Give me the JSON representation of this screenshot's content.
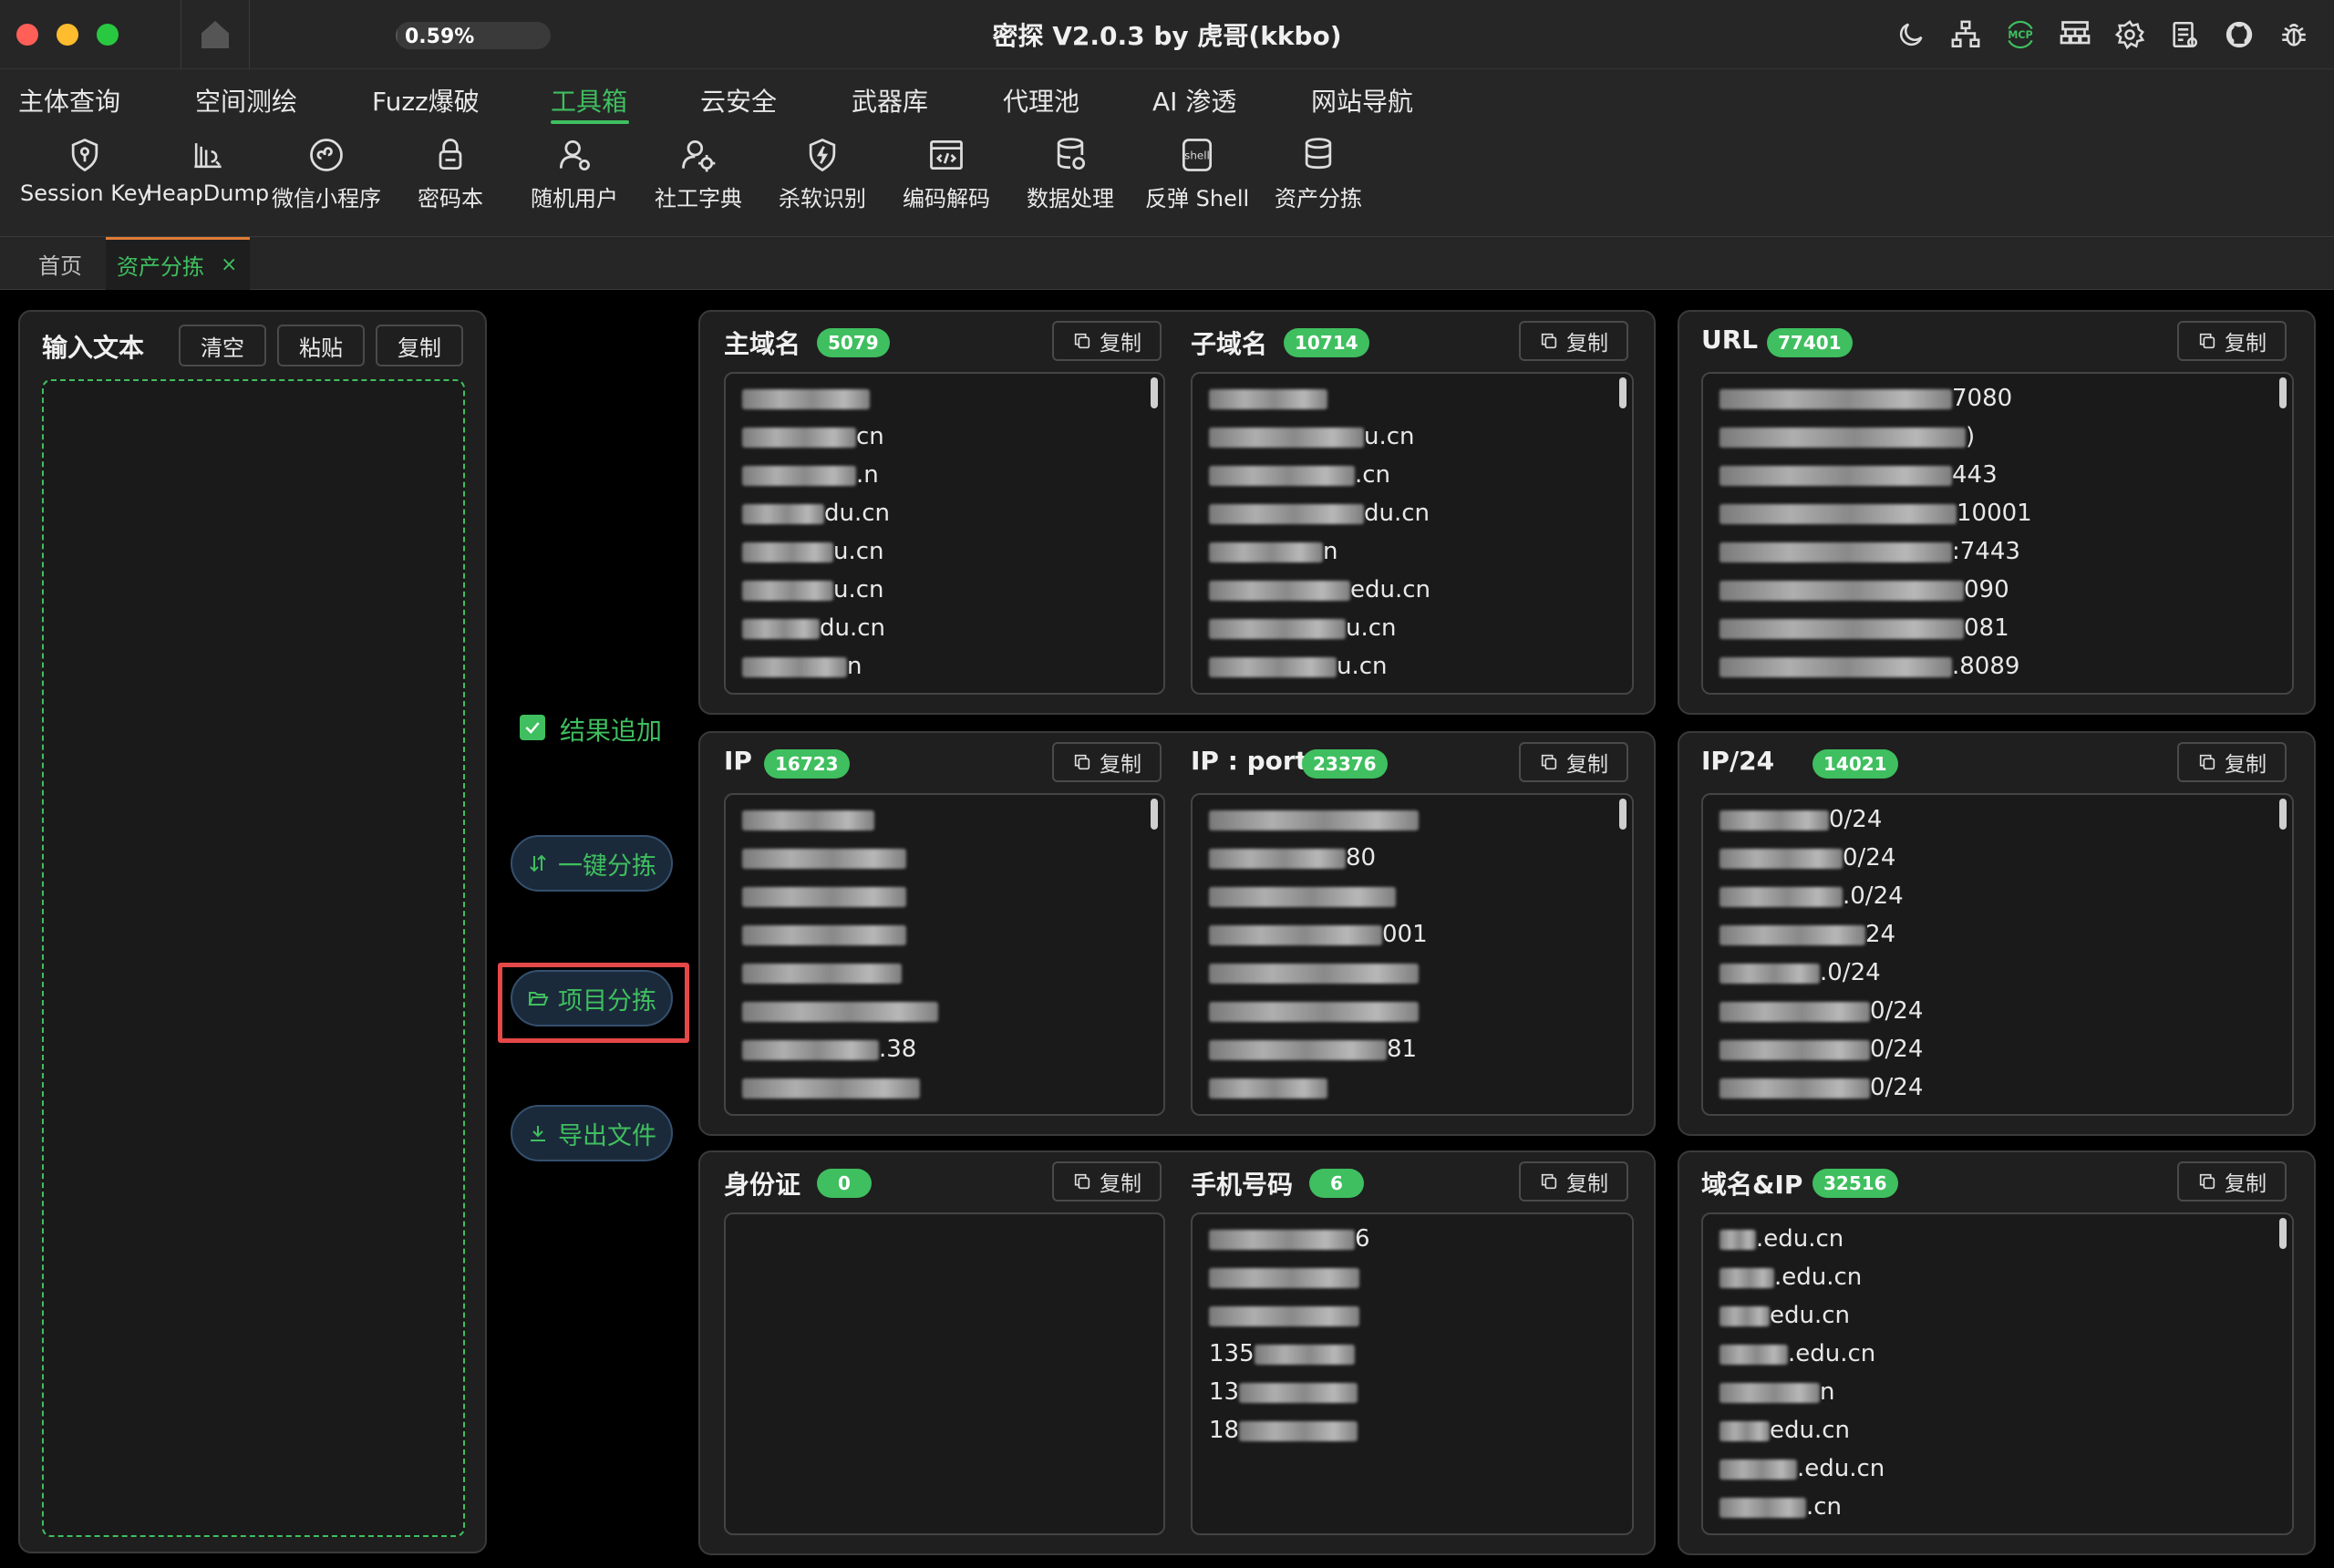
{
  "app": {
    "title": "密探 V2.0.3 by 虎哥(kkbo)",
    "progress_text": "0.59%",
    "progress_value": 0.59
  },
  "top_icons": [
    "moon-icon",
    "network-icon",
    "mcp-icon",
    "sitemap-icon",
    "settings-icon",
    "log-icon",
    "github-icon",
    "bug-icon"
  ],
  "mcp_label": "MCP",
  "menu": {
    "items": [
      {
        "label": "主体查询"
      },
      {
        "label": "空间测绘"
      },
      {
        "label": "Fuzz爆破"
      },
      {
        "label": "工具箱",
        "active": true
      },
      {
        "label": "云安全"
      },
      {
        "label": "武器库"
      },
      {
        "label": "代理池"
      },
      {
        "label": "AI 渗透"
      },
      {
        "label": "网站导航"
      }
    ]
  },
  "tools": [
    {
      "label": "Session Key",
      "icon": "key-shield-icon"
    },
    {
      "label": "HeapDump",
      "icon": "heapdump-icon"
    },
    {
      "label": "微信小程序",
      "icon": "miniprogram-icon"
    },
    {
      "label": "密码本",
      "icon": "lock-icon"
    },
    {
      "label": "随机用户",
      "icon": "user-icon"
    },
    {
      "label": "社工字典",
      "icon": "user-settings-icon"
    },
    {
      "label": "杀软识别",
      "icon": "shield-bolt-icon"
    },
    {
      "label": "编码解码",
      "icon": "code-icon"
    },
    {
      "label": "数据处理",
      "icon": "database-icon"
    },
    {
      "label": "反弹 Shell",
      "icon": "shell-icon"
    },
    {
      "label": "资产分拣",
      "icon": "database-sort-icon"
    }
  ],
  "shell_icon_text": "shell",
  "tabs": {
    "home": "首页",
    "active": "资产分拣",
    "close": "×"
  },
  "input_panel": {
    "title": "输入文本",
    "clear": "清空",
    "paste": "粘贴",
    "copy": "复制"
  },
  "controls": {
    "append_label": "结果追加",
    "append_checked": true,
    "sort_all": "一键分拣",
    "project_sort": "项目分拣",
    "export": "导出文件"
  },
  "copy_label": "复制",
  "results": {
    "main_domain": {
      "title": "主域名",
      "count": "5079",
      "lines": [
        "",
        "cn",
        ".n",
        "du.cn",
        "u.cn",
        "u.cn",
        "du.cn",
        "n"
      ]
    },
    "sub_domain": {
      "title": "子域名",
      "count": "10714",
      "lines": [
        "",
        "u.cn",
        ".cn",
        "du.cn",
        "n",
        "edu.cn",
        "u.cn",
        "u.cn"
      ]
    },
    "url": {
      "title": "URL",
      "count": "77401",
      "lines": [
        "7080",
        ")",
        "443",
        "10001",
        ":7443",
        "090",
        "081",
        ".8089"
      ]
    },
    "ip": {
      "title": "IP",
      "count": "16723",
      "lines": [
        "",
        "",
        "",
        "",
        "",
        "",
        ".38",
        ""
      ]
    },
    "ip_port": {
      "title": "IP : port",
      "count": "23376",
      "lines": [
        "",
        "80",
        "",
        "001",
        "",
        "",
        "81",
        ""
      ]
    },
    "ip24": {
      "title": "IP/24",
      "count": "14021",
      "lines": [
        "0/24",
        "0/24",
        ".0/24",
        "24",
        ".0/24",
        "0/24",
        "0/24",
        "0/24"
      ]
    },
    "id_card": {
      "title": "身份证",
      "count": "0",
      "lines": []
    },
    "phone": {
      "title": "手机号码",
      "count": "6",
      "lines": [
        "6",
        "",
        "",
        "135",
        "13",
        "18"
      ]
    },
    "domain_ip": {
      "title": "域名&IP",
      "count": "32516",
      "lines": [
        ".edu.cn",
        ".edu.cn",
        "edu.cn",
        ".edu.cn",
        "n",
        "edu.cn",
        ".edu.cn",
        ".cn"
      ]
    }
  }
}
